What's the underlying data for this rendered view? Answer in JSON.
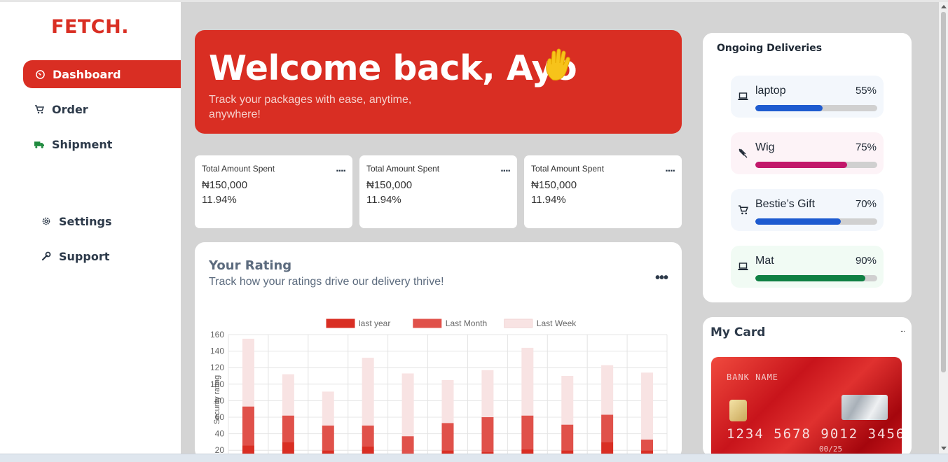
{
  "brand": {
    "logo": "FETCH.",
    "accent": "#d92e23"
  },
  "sidebar": {
    "items": [
      {
        "label": "Dashboard",
        "icon": "gauge-icon",
        "active": true
      },
      {
        "label": "Order",
        "icon": "cart-icon",
        "active": false
      },
      {
        "label": "Shipment",
        "icon": "truck-icon",
        "active": false
      },
      {
        "label": "Settings",
        "icon": "gear-icon",
        "active": false
      },
      {
        "label": "Support",
        "icon": "wrench-icon",
        "active": false
      }
    ]
  },
  "hero": {
    "title": "Welcome back, Ayo",
    "subtitle": "Track your packages with ease, anytime, anywhere!",
    "icon": "waving-hand-icon"
  },
  "stats": [
    {
      "label": "Total Amount Spent",
      "amount": "₦150,000",
      "change": "11.94%",
      "more": "...."
    },
    {
      "label": "Total Amount Spent",
      "amount": "₦150,000",
      "change": "11.94%",
      "more": "...."
    },
    {
      "label": "Total Amount Spent",
      "amount": "₦150,000",
      "change": "11.94%",
      "more": "...."
    }
  ],
  "rating": {
    "title": "Your Rating",
    "subtitle": "Track how your ratings drive our delivery thrive!",
    "more": "•••"
  },
  "chart_data": {
    "type": "bar",
    "stacked": true,
    "ylabel": "Security rating",
    "ylim": [
      0,
      160
    ],
    "yticks": [
      20,
      40,
      60,
      80,
      100,
      120,
      140,
      160
    ],
    "grid": true,
    "legend_position": "top",
    "series": [
      {
        "name": "last year",
        "color": "#d92e23",
        "values": [
          26,
          30,
          20,
          25,
          15,
          20,
          18,
          21,
          20,
          30,
          20
        ]
      },
      {
        "name": "Last Month",
        "color": "#e0514a",
        "values": [
          47,
          32,
          30,
          25,
          22,
          33,
          42,
          41,
          31,
          33,
          13
        ]
      },
      {
        "name": "Last Week",
        "color": "#f8e3e3",
        "values": [
          82,
          50,
          41,
          82,
          76,
          52,
          57,
          82,
          59,
          60,
          81
        ]
      }
    ]
  },
  "deliveries": {
    "title": "Ongoing Deliveries",
    "items": [
      {
        "name": "laptop",
        "percent": "55%",
        "progress": 0.55,
        "icon": "laptop-icon",
        "bg": "#f3f7fc",
        "color": "#1e5bd0"
      },
      {
        "name": "Wig",
        "percent": "75%",
        "progress": 0.75,
        "icon": "wig-icon",
        "bg": "#fdf3f7",
        "color": "#c2186b"
      },
      {
        "name": "Bestie’s Gift",
        "percent": "70%",
        "progress": 0.7,
        "icon": "cart-icon",
        "bg": "#f3f7fc",
        "color": "#1e5bd0"
      },
      {
        "name": "Mat",
        "percent": "90%",
        "progress": 0.9,
        "icon": "laptop-icon",
        "bg": "#f1fbf4",
        "color": "#0f8043"
      }
    ]
  },
  "mycard": {
    "title": "My Card",
    "more": "...",
    "bank_name": "BANK NAME",
    "number": "1234 5678 9012 3456",
    "expiry": "00/25"
  }
}
